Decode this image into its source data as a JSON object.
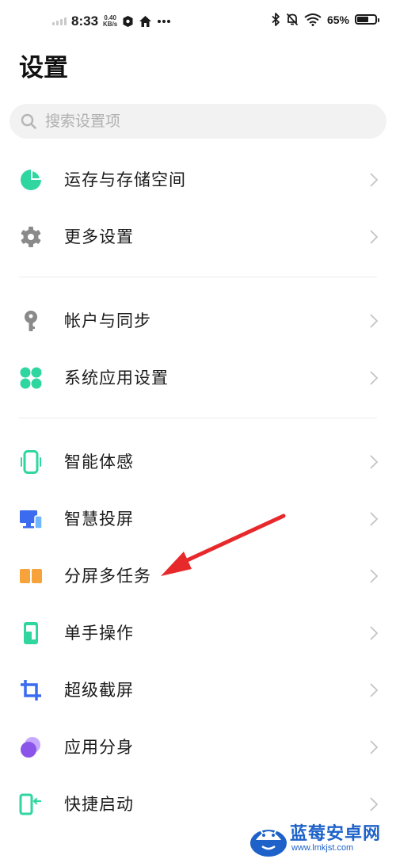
{
  "status_bar": {
    "time": "8:33",
    "net_speed_value": "0.40",
    "net_speed_unit": "KB/s",
    "battery_percent": "65%",
    "battery_level": 0.65,
    "icons": [
      "signal-icon",
      "shield-icon",
      "home-icon",
      "more-icon",
      "bluetooth-icon",
      "mute-bell-icon",
      "wifi-icon",
      "battery-icon"
    ]
  },
  "header": {
    "title": "设置"
  },
  "search": {
    "placeholder": "搜索设置项"
  },
  "groups": [
    {
      "items": [
        {
          "label": "运存与存储空间",
          "icon": "storage-pie-icon",
          "color": "#2fd6a0"
        },
        {
          "label": "更多设置",
          "icon": "gear-icon",
          "color": "#8a8a8a"
        }
      ]
    },
    {
      "items": [
        {
          "label": "帐户与同步",
          "icon": "key-icon",
          "color": "#8a8a8a"
        },
        {
          "label": "系统应用设置",
          "icon": "apps-icon",
          "color": "#2fd6a0"
        }
      ]
    },
    {
      "items": [
        {
          "label": "智能体感",
          "icon": "phone-motion-icon",
          "color": "#2fd6a0"
        },
        {
          "label": "智慧投屏",
          "icon": "screen-cast-icon",
          "color": "#3b6cf0"
        },
        {
          "label": "分屏多任务",
          "icon": "split-screen-icon",
          "color": "#f7a23b"
        },
        {
          "label": "单手操作",
          "icon": "one-hand-icon",
          "color": "#2fd6a0"
        },
        {
          "label": "超级截屏",
          "icon": "crop-icon",
          "color": "#3b6cf0"
        },
        {
          "label": "应用分身",
          "icon": "app-clone-icon",
          "color": "#8a55e8"
        },
        {
          "label": "快捷启动",
          "icon": "quick-launch-icon",
          "color": "#2fd6a0"
        }
      ]
    }
  ],
  "annotation": {
    "color": "#e8292b",
    "points_to": "分屏多任务"
  },
  "watermark": {
    "text": "蓝莓安卓网",
    "url": "www.lmkjst.com",
    "color": "#1e62c9"
  }
}
